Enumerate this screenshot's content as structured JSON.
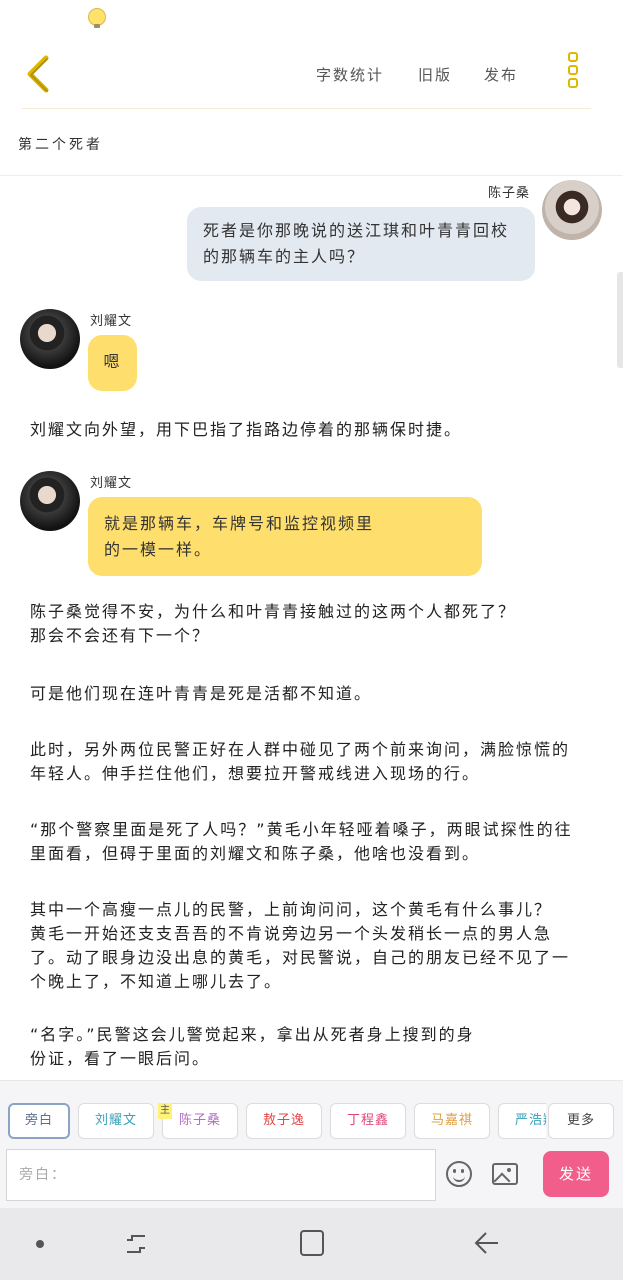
{
  "header": {
    "word_count_label": "字数统计",
    "old_version_label": "旧版",
    "publish_label": "发布"
  },
  "chapter_title": "第二个死者",
  "messages": [
    {
      "speaker": "陈子桑",
      "text_lines": [
        "死者是你那晚说的送江琪和叶青青回校",
        "的那辆车的主人吗？"
      ]
    },
    {
      "speaker": "刘耀文",
      "text": "嗯"
    },
    {
      "narration": "刘耀文向外望，用下巴指了指路边停着的那辆保时捷。"
    },
    {
      "speaker": "刘耀文",
      "text_lines": [
        "就是那辆车，车牌号和监控视频里",
        "的一模一样。"
      ]
    },
    {
      "narration_lines": [
        "陈子桑觉得不安，为什么和叶青青接触过的这两个人都死了？",
        "那会不会还有下一个？"
      ]
    },
    {
      "narration": "可是他们现在连叶青青是死是活都不知道。"
    },
    {
      "narration_lines": [
        "此时，另外两位民警正好在人群中碰见了两个前来询问，满脸惊慌的",
        "年轻人。伸手拦住他们，想要拉开警戒线进入现场的行。"
      ]
    },
    {
      "narration_lines": [
        "“那个警察里面是死了人吗？”黄毛小年轻哑着嗓子，两眼试探性的往",
        "里面看，但碍于里面的刘耀文和陈子桑，他啥也没看到。"
      ]
    },
    {
      "narration_lines": [
        "其中一个高瘦一点儿的民警，上前询问问，这个黄毛有什么事儿？",
        "黄毛一开始还支支吾吾的不肯说旁边另一个头发稍长一点的男人急",
        "了。动了眼身边没出息的黄毛，对民警说，自己的朋友已经不见了一",
        "个晚上了，不知道上哪儿去了。"
      ]
    },
    {
      "narration_lines": [
        "“名字。”民警这会儿警觉起来，拿出从死者身上搜到的身",
        "份证，看了一眼后问。"
      ]
    }
  ],
  "character_chips": [
    "旁白",
    "刘耀文",
    "陈子桑",
    "敖子逸",
    "丁程鑫",
    "马嘉祺",
    "严浩翔"
  ],
  "main_tag": "主",
  "more_label": "更多",
  "input": {
    "placeholder": "旁白："
  },
  "send_label": "发送",
  "colors": {
    "accent_yellow": "#fedf6d",
    "bubble_blue": "#e3e9f1",
    "send_pink": "#f15e8c",
    "chip_colors": [
      "#5a6f8f",
      "#3aa0b8",
      "#b070c8",
      "#e04848",
      "#e04878",
      "#e0a040",
      "#3aa0b8"
    ]
  },
  "icons": {
    "status": "lightbulb-icon",
    "back": "chevron-left-icon",
    "menu": "vertical-dots-icon",
    "emoji": "smiley-icon",
    "image": "image-icon"
  }
}
